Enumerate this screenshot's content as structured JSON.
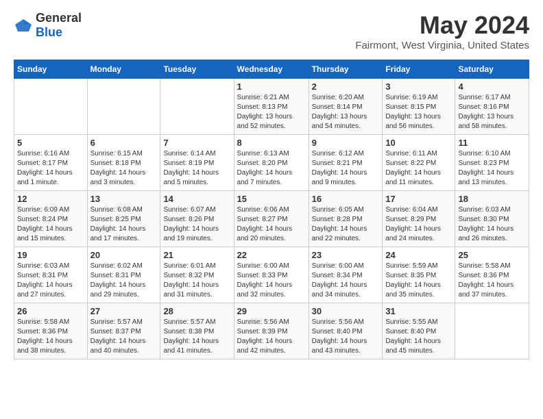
{
  "header": {
    "logo_general": "General",
    "logo_blue": "Blue",
    "month_year": "May 2024",
    "location": "Fairmont, West Virginia, United States"
  },
  "columns": [
    "Sunday",
    "Monday",
    "Tuesday",
    "Wednesday",
    "Thursday",
    "Friday",
    "Saturday"
  ],
  "weeks": [
    [
      {
        "day": "",
        "sunrise": "",
        "sunset": "",
        "daylight": ""
      },
      {
        "day": "",
        "sunrise": "",
        "sunset": "",
        "daylight": ""
      },
      {
        "day": "",
        "sunrise": "",
        "sunset": "",
        "daylight": ""
      },
      {
        "day": "1",
        "sunrise": "Sunrise: 6:21 AM",
        "sunset": "Sunset: 8:13 PM",
        "daylight": "Daylight: 13 hours and 52 minutes."
      },
      {
        "day": "2",
        "sunrise": "Sunrise: 6:20 AM",
        "sunset": "Sunset: 8:14 PM",
        "daylight": "Daylight: 13 hours and 54 minutes."
      },
      {
        "day": "3",
        "sunrise": "Sunrise: 6:19 AM",
        "sunset": "Sunset: 8:15 PM",
        "daylight": "Daylight: 13 hours and 56 minutes."
      },
      {
        "day": "4",
        "sunrise": "Sunrise: 6:17 AM",
        "sunset": "Sunset: 8:16 PM",
        "daylight": "Daylight: 13 hours and 58 minutes."
      }
    ],
    [
      {
        "day": "5",
        "sunrise": "Sunrise: 6:16 AM",
        "sunset": "Sunset: 8:17 PM",
        "daylight": "Daylight: 14 hours and 1 minute."
      },
      {
        "day": "6",
        "sunrise": "Sunrise: 6:15 AM",
        "sunset": "Sunset: 8:18 PM",
        "daylight": "Daylight: 14 hours and 3 minutes."
      },
      {
        "day": "7",
        "sunrise": "Sunrise: 6:14 AM",
        "sunset": "Sunset: 8:19 PM",
        "daylight": "Daylight: 14 hours and 5 minutes."
      },
      {
        "day": "8",
        "sunrise": "Sunrise: 6:13 AM",
        "sunset": "Sunset: 8:20 PM",
        "daylight": "Daylight: 14 hours and 7 minutes."
      },
      {
        "day": "9",
        "sunrise": "Sunrise: 6:12 AM",
        "sunset": "Sunset: 8:21 PM",
        "daylight": "Daylight: 14 hours and 9 minutes."
      },
      {
        "day": "10",
        "sunrise": "Sunrise: 6:11 AM",
        "sunset": "Sunset: 8:22 PM",
        "daylight": "Daylight: 14 hours and 11 minutes."
      },
      {
        "day": "11",
        "sunrise": "Sunrise: 6:10 AM",
        "sunset": "Sunset: 8:23 PM",
        "daylight": "Daylight: 14 hours and 13 minutes."
      }
    ],
    [
      {
        "day": "12",
        "sunrise": "Sunrise: 6:09 AM",
        "sunset": "Sunset: 8:24 PM",
        "daylight": "Daylight: 14 hours and 15 minutes."
      },
      {
        "day": "13",
        "sunrise": "Sunrise: 6:08 AM",
        "sunset": "Sunset: 8:25 PM",
        "daylight": "Daylight: 14 hours and 17 minutes."
      },
      {
        "day": "14",
        "sunrise": "Sunrise: 6:07 AM",
        "sunset": "Sunset: 8:26 PM",
        "daylight": "Daylight: 14 hours and 19 minutes."
      },
      {
        "day": "15",
        "sunrise": "Sunrise: 6:06 AM",
        "sunset": "Sunset: 8:27 PM",
        "daylight": "Daylight: 14 hours and 20 minutes."
      },
      {
        "day": "16",
        "sunrise": "Sunrise: 6:05 AM",
        "sunset": "Sunset: 8:28 PM",
        "daylight": "Daylight: 14 hours and 22 minutes."
      },
      {
        "day": "17",
        "sunrise": "Sunrise: 6:04 AM",
        "sunset": "Sunset: 8:29 PM",
        "daylight": "Daylight: 14 hours and 24 minutes."
      },
      {
        "day": "18",
        "sunrise": "Sunrise: 6:03 AM",
        "sunset": "Sunset: 8:30 PM",
        "daylight": "Daylight: 14 hours and 26 minutes."
      }
    ],
    [
      {
        "day": "19",
        "sunrise": "Sunrise: 6:03 AM",
        "sunset": "Sunset: 8:31 PM",
        "daylight": "Daylight: 14 hours and 27 minutes."
      },
      {
        "day": "20",
        "sunrise": "Sunrise: 6:02 AM",
        "sunset": "Sunset: 8:31 PM",
        "daylight": "Daylight: 14 hours and 29 minutes."
      },
      {
        "day": "21",
        "sunrise": "Sunrise: 6:01 AM",
        "sunset": "Sunset: 8:32 PM",
        "daylight": "Daylight: 14 hours and 31 minutes."
      },
      {
        "day": "22",
        "sunrise": "Sunrise: 6:00 AM",
        "sunset": "Sunset: 8:33 PM",
        "daylight": "Daylight: 14 hours and 32 minutes."
      },
      {
        "day": "23",
        "sunrise": "Sunrise: 6:00 AM",
        "sunset": "Sunset: 8:34 PM",
        "daylight": "Daylight: 14 hours and 34 minutes."
      },
      {
        "day": "24",
        "sunrise": "Sunrise: 5:59 AM",
        "sunset": "Sunset: 8:35 PM",
        "daylight": "Daylight: 14 hours and 35 minutes."
      },
      {
        "day": "25",
        "sunrise": "Sunrise: 5:58 AM",
        "sunset": "Sunset: 8:36 PM",
        "daylight": "Daylight: 14 hours and 37 minutes."
      }
    ],
    [
      {
        "day": "26",
        "sunrise": "Sunrise: 5:58 AM",
        "sunset": "Sunset: 8:36 PM",
        "daylight": "Daylight: 14 hours and 38 minutes."
      },
      {
        "day": "27",
        "sunrise": "Sunrise: 5:57 AM",
        "sunset": "Sunset: 8:37 PM",
        "daylight": "Daylight: 14 hours and 40 minutes."
      },
      {
        "day": "28",
        "sunrise": "Sunrise: 5:57 AM",
        "sunset": "Sunset: 8:38 PM",
        "daylight": "Daylight: 14 hours and 41 minutes."
      },
      {
        "day": "29",
        "sunrise": "Sunrise: 5:56 AM",
        "sunset": "Sunset: 8:39 PM",
        "daylight": "Daylight: 14 hours and 42 minutes."
      },
      {
        "day": "30",
        "sunrise": "Sunrise: 5:56 AM",
        "sunset": "Sunset: 8:40 PM",
        "daylight": "Daylight: 14 hours and 43 minutes."
      },
      {
        "day": "31",
        "sunrise": "Sunrise: 5:55 AM",
        "sunset": "Sunset: 8:40 PM",
        "daylight": "Daylight: 14 hours and 45 minutes."
      },
      {
        "day": "",
        "sunrise": "",
        "sunset": "",
        "daylight": ""
      }
    ]
  ]
}
